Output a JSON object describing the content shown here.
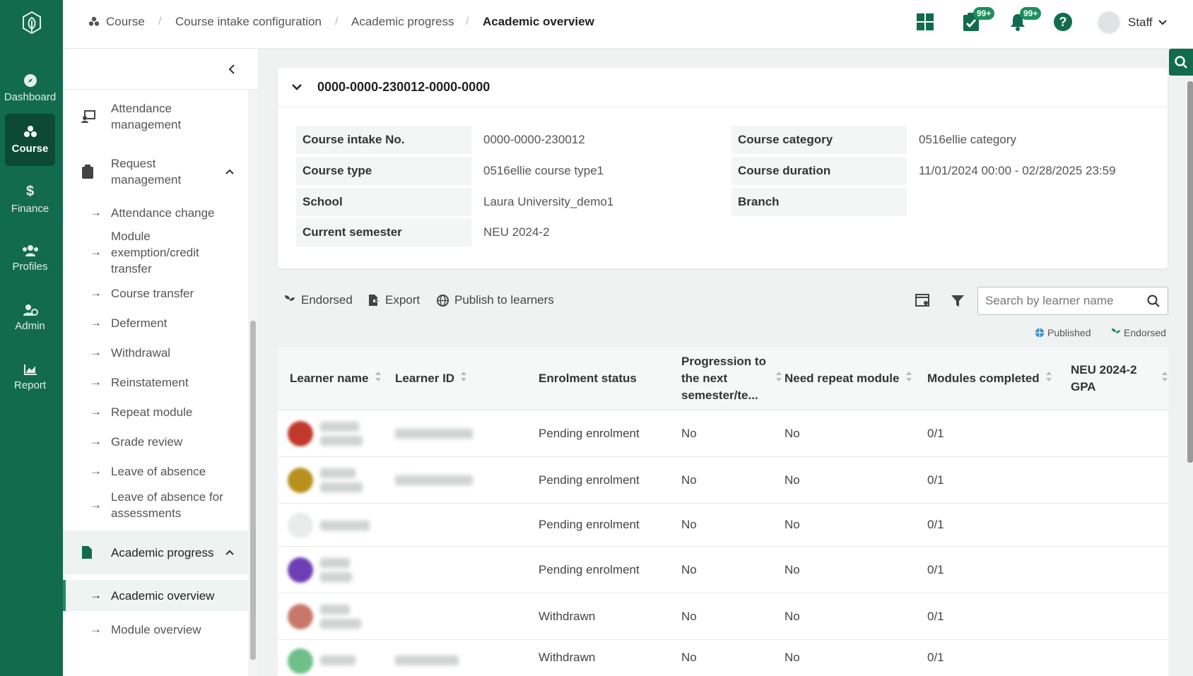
{
  "rail": {
    "items": [
      {
        "label": "Dashboard",
        "icon": "compass-icon"
      },
      {
        "label": "Course",
        "icon": "course-icon",
        "active": true
      },
      {
        "label": "Finance",
        "icon": "dollar-icon"
      },
      {
        "label": "Profiles",
        "icon": "users-icon"
      },
      {
        "label": "Admin",
        "icon": "admin-icon"
      },
      {
        "label": "Report",
        "icon": "chart-icon"
      }
    ]
  },
  "header": {
    "breadcrumb": [
      "Course",
      "Course intake configuration",
      "Academic progress",
      "Academic overview"
    ],
    "tasks_badge": "99+",
    "notifications_badge": "99+",
    "user": "Staff"
  },
  "sidenav": {
    "items": [
      {
        "label": "Attendance management",
        "type": "group"
      },
      {
        "label": "Request management",
        "type": "group"
      },
      {
        "label": "Attendance change",
        "type": "sub"
      },
      {
        "label": "Module exemption/credit transfer",
        "type": "sub"
      },
      {
        "label": "Course transfer",
        "type": "sub"
      },
      {
        "label": "Deferment",
        "type": "sub"
      },
      {
        "label": "Withdrawal",
        "type": "sub"
      },
      {
        "label": "Reinstatement",
        "type": "sub"
      },
      {
        "label": "Repeat module",
        "type": "sub"
      },
      {
        "label": "Grade review",
        "type": "sub"
      },
      {
        "label": "Leave of absence",
        "type": "sub"
      },
      {
        "label": "Leave of absence for assessments",
        "type": "sub"
      },
      {
        "label": "Academic progress",
        "type": "group"
      },
      {
        "label": "Academic overview",
        "type": "sub"
      },
      {
        "label": "Module overview",
        "type": "sub"
      }
    ]
  },
  "intake": {
    "title": "0000-0000-230012-0000-0000",
    "left": [
      {
        "key": "Course intake No.",
        "value": "0000-0000-230012"
      },
      {
        "key": "Course type",
        "value": "0516ellie course type1"
      },
      {
        "key": "School",
        "value": "Laura University_demo1"
      },
      {
        "key": "Current semester",
        "value": "NEU 2024-2"
      }
    ],
    "right": [
      {
        "key": "Course category",
        "value": "0516ellie category"
      },
      {
        "key": "Course duration",
        "value": "11/01/2024 00:00 - 02/28/2025 23:59"
      },
      {
        "key": "Branch",
        "value": ""
      }
    ]
  },
  "toolbar": {
    "endorsed": "Endorsed",
    "export": "Export",
    "publish": "Publish to learners",
    "search_placeholder": "Search by learner name"
  },
  "legend": {
    "published": "Published",
    "endorsed": "Endorsed"
  },
  "table": {
    "columns": [
      "Learner name",
      "Learner ID",
      "Enrolment status",
      "Progression to the next semester/te...",
      "Need repeat module",
      "Modules completed",
      "NEU 2024-2 GPA"
    ],
    "rows": [
      {
        "status": "Pending enrolment",
        "progression": "No",
        "repeat": "No",
        "completed": "0/1"
      },
      {
        "status": "Pending enrolment",
        "progression": "No",
        "repeat": "No",
        "completed": "0/1"
      },
      {
        "status": "Pending enrolment",
        "progression": "No",
        "repeat": "No",
        "completed": "0/1"
      },
      {
        "status": "Pending enrolment",
        "progression": "No",
        "repeat": "No",
        "completed": "0/1"
      },
      {
        "status": "Withdrawn",
        "progression": "No",
        "repeat": "No",
        "completed": "0/1"
      },
      {
        "status": "Withdrawn",
        "progression": "No",
        "repeat": "No",
        "completed": "0/1"
      }
    ]
  },
  "colors": {
    "brand": "#126b4d",
    "accent": "#1d8f5c"
  }
}
